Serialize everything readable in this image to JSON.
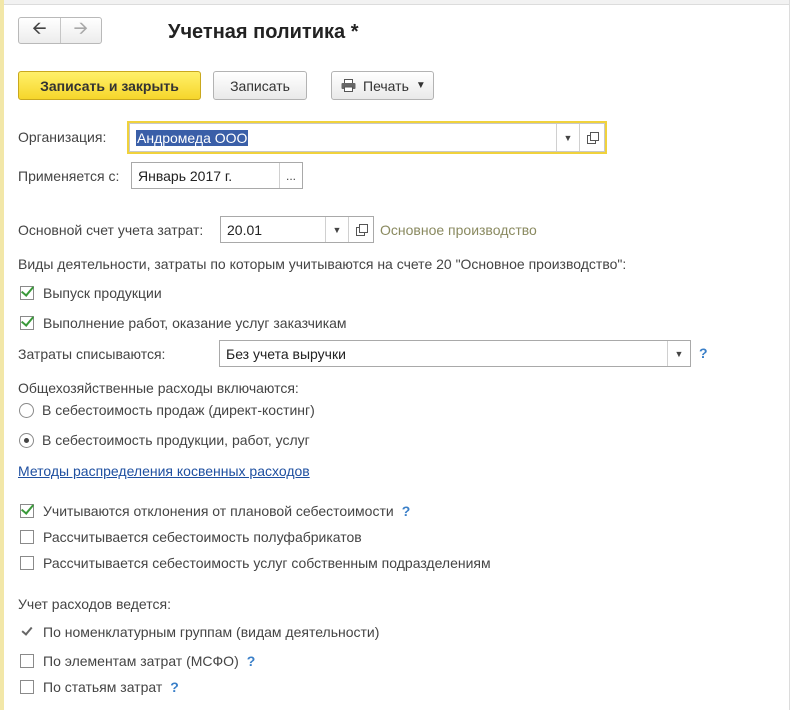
{
  "window": {
    "title": "Учетная политика *"
  },
  "toolbar": {
    "save_close_label": "Записать и закрыть",
    "save_label": "Записать",
    "print_label": "Печать"
  },
  "organization": {
    "label": "Организация:",
    "value": "Андромеда ООО"
  },
  "applies_from": {
    "label": "Применяется с:",
    "value": "Январь 2017 г.",
    "picker": "..."
  },
  "cost_account": {
    "label": "Основной счет учета затрат:",
    "value": "20.01",
    "name": "Основное производство"
  },
  "activity_heading": "Виды деятельности, затраты по которым учитываются на счете 20 \"Основное производство\":",
  "activities": [
    {
      "label": "Выпуск продукции",
      "checked": true
    },
    {
      "label": "Выполнение работ, оказание услуг заказчикам",
      "checked": true
    }
  ],
  "writeoff": {
    "label": "Затраты списываются:",
    "value": "Без учета выручки",
    "help": "?"
  },
  "overhead": {
    "heading": "Общехозяйственные расходы включаются:",
    "options": [
      {
        "label": "В себестоимость продаж (директ-костинг)",
        "selected": false
      },
      {
        "label": "В  себестоимость продукции, работ, услуг",
        "selected": true
      }
    ]
  },
  "methods_link": "Методы распределения косвенных расходов",
  "cost_options": [
    {
      "label": "Учитываются отклонения от плановой себестоимости",
      "checked": true,
      "help": "?"
    },
    {
      "label": "Рассчитывается себестоимость полуфабрикатов",
      "checked": false
    },
    {
      "label": "Рассчитывается себестоимость услуг собственным подразделениям",
      "checked": false
    }
  ],
  "accounting": {
    "heading": "Учет расходов ведется:",
    "options": [
      {
        "label": "По номенклатурным группам (видам деятельности)",
        "checked": true
      },
      {
        "label": "По элементам затрат (МСФО)",
        "checked": false,
        "help": "?"
      },
      {
        "label": "По статьям затрат",
        "checked": false,
        "help": "?"
      }
    ]
  },
  "colors": {
    "primary_button": "#f6d62b",
    "focus_border": "#f0d23c",
    "check": "#3a9a3a",
    "link": "#1e4fa0",
    "help": "#3a7fc8"
  },
  "icons": {
    "back": "arrow-left-icon",
    "forward": "arrow-right-icon",
    "print": "printer-icon",
    "dropdown": "chevron-down-icon",
    "open": "open-form-icon"
  }
}
